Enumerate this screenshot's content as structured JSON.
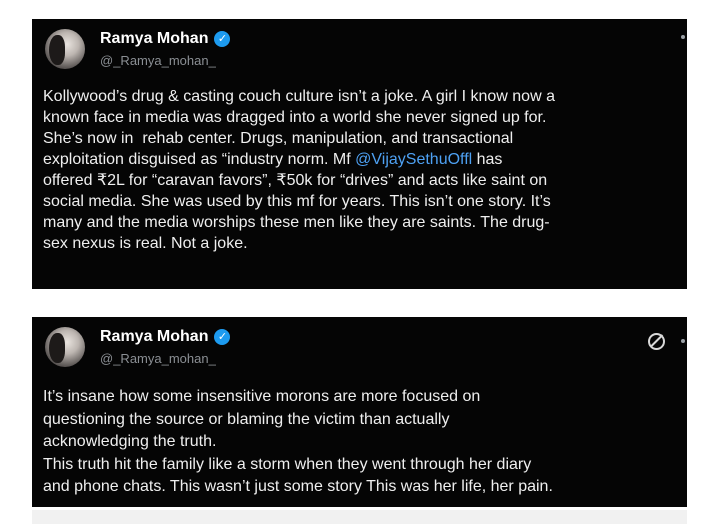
{
  "tweets": [
    {
      "author_name": "Ramya Mohan",
      "handle": "@_Ramya_mohan_",
      "lines": [
        "Kollywood’s drug & casting couch culture isn’t a joke. A girl I know now a",
        "known face in media was dragged into a world she never signed up for.",
        "She’s now in  rehab center. Drugs, manipulation, and transactional",
        "exploitation disguised as “industry norm. Mf ",
        "@VijaySethuOffl",
        " has",
        "offered ₹2L for “caravan favors”, ₹50k for “drives” and acts like saint on",
        "social media. She was used by this mf for years. This isn’t one story. It’s",
        "many and the media worships these men like they are saints. The drug-",
        "sex nexus is real. Not a joke."
      ]
    },
    {
      "author_name": "Ramya Mohan",
      "handle": "@_Ramya_mohan_",
      "lines": [
        "It’s insane how some insensitive morons are more focused on",
        "questioning the source or blaming the victim than actually",
        "acknowledging the truth.",
        "This truth hit the family like a storm when they went through her diary",
        "and phone chats. This wasn’t just some story This was her life, her pain."
      ]
    }
  ]
}
